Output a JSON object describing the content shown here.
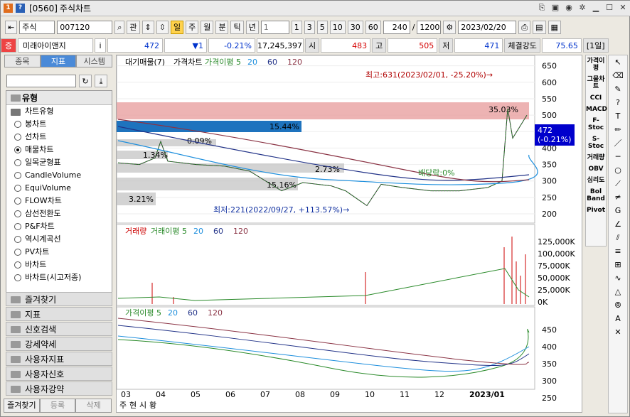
{
  "window": {
    "code": "[0560]",
    "title": "주식차트",
    "code_icon": "1",
    "help_icon": "?"
  },
  "toolbar": {
    "market": "주식",
    "code": "007120",
    "btn_kwan": "관",
    "periods": [
      "일",
      "주",
      "월",
      "분",
      "틱",
      "년"
    ],
    "sub_select": "1",
    "nums": [
      "1",
      "3",
      "5",
      "10",
      "30",
      "60"
    ],
    "count": "240",
    "max": "1200",
    "date": "2023/02/20"
  },
  "info": {
    "sign": "증",
    "name": "미래아이앤지",
    "tag": "i",
    "price": "472",
    "change": "▼1",
    "rate": "-0.21%",
    "volume": "17,245,397",
    "open_lbl": "시",
    "open": "483",
    "high_lbl": "고",
    "high": "505",
    "low_lbl": "저",
    "low": "471",
    "str_lbl": "체결강도",
    "strength": "75.65",
    "period_tag": "[1일]"
  },
  "left_tabs": [
    "종목",
    "지표",
    "시스템"
  ],
  "tree": {
    "header": "유형",
    "group": "차트유형",
    "items": [
      "봉차트",
      "선차트",
      "매물차트",
      "일목균형표",
      "CandleVolume",
      "EquiVolume",
      "FLOW차트",
      "삼선전환도",
      "P&F차트",
      "역시계곡선",
      "PV차트",
      "바차트",
      "바차트(시고저종)"
    ],
    "selected": 2
  },
  "categories": [
    "즐겨찾기",
    "지표",
    "신호검색",
    "강세약세",
    "사용자지표",
    "사용자신호",
    "사용자강약"
  ],
  "bottom_tabs": [
    "즐겨찾기",
    "등록",
    "삭제"
  ],
  "right_indicators": [
    "가격이평",
    "그물차트",
    "CCI",
    "MACD",
    "F-Stoc",
    "S-Stoc",
    "거래량",
    "OBV",
    "심리도",
    "Bol Band",
    "Pivot"
  ],
  "chart_labels": {
    "price_legend": [
      "대기매물(7)",
      "가격차트",
      "가격이평 5",
      "20",
      "60",
      "120"
    ],
    "vol_legend": [
      "거래량",
      "거래이평 5",
      "20",
      "60",
      "120"
    ],
    "ma_legend": [
      "가격이평 5",
      "20",
      "60",
      "120"
    ],
    "high_note": "최고:631(2023/02/01, -25.20%)→",
    "low_note": "최저:221(2022/09/27, +113.57%)→",
    "div_note": "배당락:0%",
    "price_tag": "472",
    "price_tag_sub": "(-0.21%)",
    "bar_labels": [
      "35.03%",
      "15.44%",
      "0.09%",
      "1.34%",
      "2.73%",
      "15.16%",
      "3.21%"
    ],
    "bottom_tabs": [
      "주",
      "현",
      "시",
      "황"
    ]
  },
  "chart_data": [
    {
      "type": "line",
      "title": "",
      "x_ticks": [
        "03",
        "04",
        "05",
        "06",
        "07",
        "08",
        "09",
        "10",
        "11",
        "12",
        "2023/01"
      ],
      "y_ticks": [
        650,
        600,
        550,
        500,
        450,
        400,
        350,
        300,
        250,
        200
      ],
      "ylim": [
        185,
        660
      ]
    },
    {
      "type": "bar",
      "title": "",
      "y_ticks": [
        "125,000K",
        "100,000K",
        "75,000K",
        "50,000K",
        "25,000K",
        "0K"
      ]
    },
    {
      "type": "line",
      "title": "",
      "y_ticks": [
        450,
        400,
        350,
        300,
        250
      ]
    }
  ]
}
